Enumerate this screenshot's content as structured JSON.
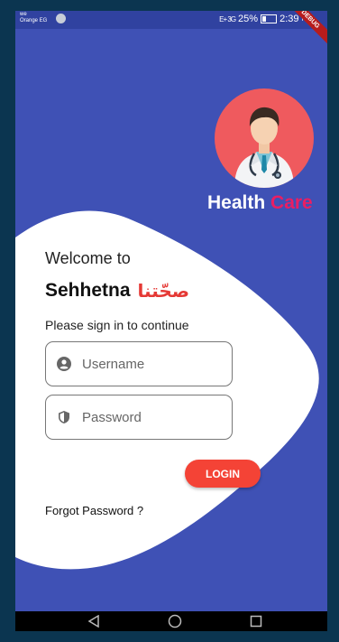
{
  "status_bar": {
    "carrier_line1": "we",
    "carrier_line2": "Orange EG",
    "signal": "E+ 3G",
    "battery": "25%",
    "time": "2:39",
    "time_suffix": "PM",
    "debug_banner": "DEBUG"
  },
  "header": {
    "brand_part1": "Health",
    "brand_part2": "Care",
    "avatar_icon": "doctor-avatar-icon"
  },
  "login": {
    "welcome": "Welcome to",
    "app_name": "Sehhetna",
    "app_name_arabic": "صحّتنا",
    "subtitle": "Please sign in to continue",
    "username_placeholder": "Username",
    "password_placeholder": "Password",
    "login_button": "LOGIN",
    "forgot_password": "Forgot Password ?"
  },
  "colors": {
    "background": "#3f51b5",
    "accent_red": "#f44336",
    "brand_pink": "#e91e63",
    "avatar_bg": "#ef5a5e"
  },
  "nav_bar": {
    "icons": [
      "back-icon",
      "home-icon",
      "recents-icon"
    ]
  }
}
